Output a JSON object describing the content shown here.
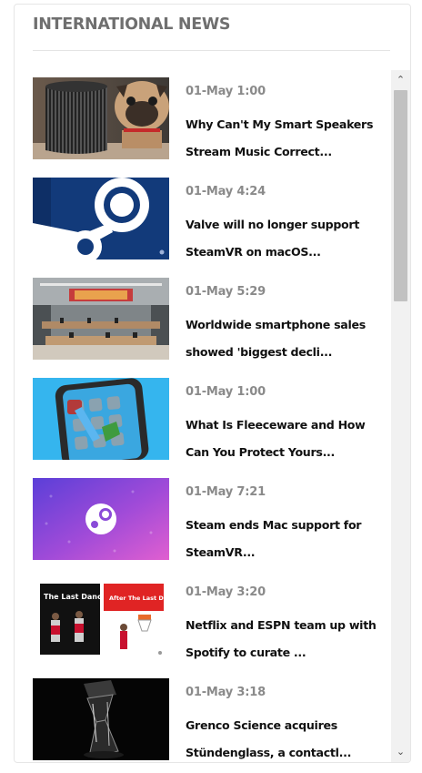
{
  "widget": {
    "title": "INTERNATIONAL NEWS"
  },
  "scrollbar": {
    "up_glyph": "⌃",
    "down_glyph": "⌄"
  },
  "items": [
    {
      "time": "01-May 1:00",
      "headline": "Why Can't My Smart Speakers Stream Music Correct...",
      "image": "smart-speaker-pug-image"
    },
    {
      "time": "01-May 4:24",
      "headline": "Valve will no longer support SteamVR on macOS...",
      "image": "steam-logo-image"
    },
    {
      "time": "01-May 5:29",
      "headline": "Worldwide smartphone sales showed 'biggest decli...",
      "image": "apple-store-image"
    },
    {
      "time": "01-May 1:00",
      "headline": "What Is Fleeceware and How Can You Protect Yours...",
      "image": "phone-apps-illustration"
    },
    {
      "time": "01-May 7:21",
      "headline": "Steam ends Mac support for SteamVR...",
      "image": "steam-purple-image"
    },
    {
      "time": "01-May 3:20",
      "headline": "Netflix and ESPN team up with Spotify to curate ...",
      "image": "last-dance-image",
      "image_text": [
        "The Last Dance",
        "After The Last Dance"
      ]
    },
    {
      "time": "01-May 3:18",
      "headline": "Grenco Science acquires Stündenglass, a contactl...",
      "image": "hourglass-device-image"
    }
  ]
}
